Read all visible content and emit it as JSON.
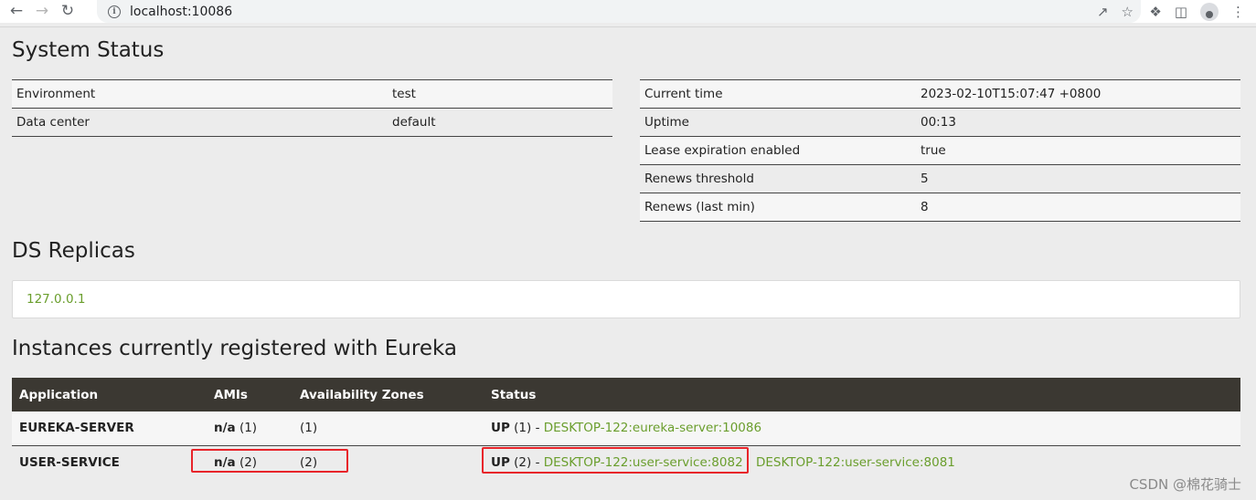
{
  "browser": {
    "url": "localhost:10086"
  },
  "system_status": {
    "title": "System Status",
    "left": [
      {
        "key": "Environment",
        "value": "test"
      },
      {
        "key": "Data center",
        "value": "default"
      }
    ],
    "right": [
      {
        "key": "Current time",
        "value": "2023-02-10T15:07:47 +0800"
      },
      {
        "key": "Uptime",
        "value": "00:13"
      },
      {
        "key": "Lease expiration enabled",
        "value": "true"
      },
      {
        "key": "Renews threshold",
        "value": "5"
      },
      {
        "key": "Renews (last min)",
        "value": "8"
      }
    ]
  },
  "ds_replicas": {
    "title": "DS Replicas",
    "items": [
      "127.0.0.1"
    ]
  },
  "instances": {
    "title": "Instances currently registered with Eureka",
    "headers": [
      "Application",
      "AMIs",
      "Availability Zones",
      "Status"
    ],
    "rows": [
      {
        "application": "EUREKA-SERVER",
        "amis_bold": "n/a",
        "amis_count": " (1)",
        "zones": "(1)",
        "status_bold": "UP",
        "status_count": " (1) - ",
        "links": [
          "DESKTOP-122:eureka-server:10086"
        ]
      },
      {
        "application": "USER-SERVICE",
        "amis_bold": "n/a",
        "amis_count": " (2)",
        "zones": "(2)",
        "status_bold": "UP",
        "status_count": " (2) - ",
        "links": [
          "DESKTOP-122:user-service:8082",
          "DESKTOP-122:user-service:8081"
        ]
      }
    ]
  },
  "watermark": "CSDN @棉花骑士",
  "colors": {
    "link_green": "#6a9e2d",
    "header_bg": "#3b3832",
    "highlight_red": "#e8242a"
  }
}
